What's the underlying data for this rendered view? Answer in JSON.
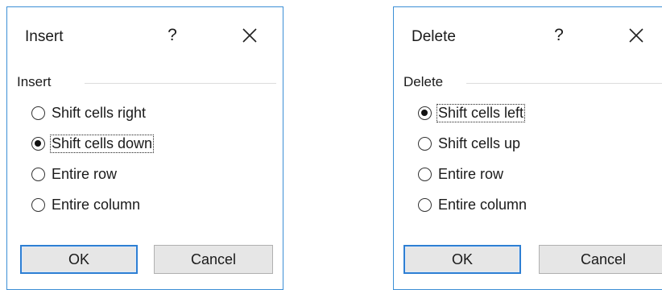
{
  "insert_dialog": {
    "title": "Insert",
    "help": "?",
    "group_label": "Insert",
    "options": [
      {
        "label": "Shift cells right",
        "checked": false
      },
      {
        "label": "Shift cells down",
        "checked": true
      },
      {
        "label": "Entire row",
        "checked": false
      },
      {
        "label": "Entire column",
        "checked": false
      }
    ],
    "ok_label": "OK",
    "cancel_label": "Cancel"
  },
  "delete_dialog": {
    "title": "Delete",
    "help": "?",
    "group_label": "Delete",
    "options": [
      {
        "label": "Shift cells left",
        "checked": true
      },
      {
        "label": "Shift cells up",
        "checked": false
      },
      {
        "label": "Entire row",
        "checked": false
      },
      {
        "label": "Entire column",
        "checked": false
      }
    ],
    "ok_label": "OK",
    "cancel_label": "Cancel"
  },
  "colors": {
    "accent": "#2e7fd3",
    "button_face": "#e6e6e6",
    "window_border": "#3c8fd6"
  },
  "icons": {
    "close": "close-icon",
    "help": "help-icon",
    "radio": "radio-button-icon"
  }
}
